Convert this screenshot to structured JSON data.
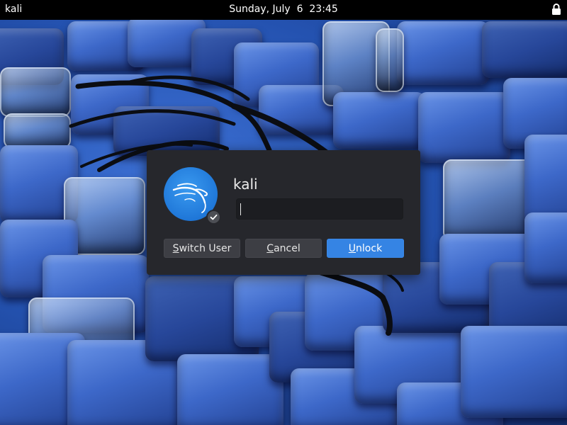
{
  "topbar": {
    "user": "kali",
    "clock": "Sunday, July  6  23:45",
    "lock_icon": "lock-icon"
  },
  "dialog": {
    "avatar_icon": "kali-dragon-icon",
    "badge_icon": "checkmark-icon",
    "username": "kali",
    "password": {
      "value": "",
      "placeholder": ""
    },
    "buttons": [
      {
        "label_mnemonic": "S",
        "label_rest": "witch User"
      },
      {
        "label_mnemonic": "C",
        "label_rest": "ancel"
      },
      {
        "label_mnemonic": "U",
        "label_rest": "nlock"
      }
    ]
  },
  "colors": {
    "topbar_bg": "#000000",
    "dialog_bg": "#26272c",
    "button_bg": "#3d3e44",
    "accent": "#3584e4",
    "avatar_bg": "#1f77d8"
  }
}
